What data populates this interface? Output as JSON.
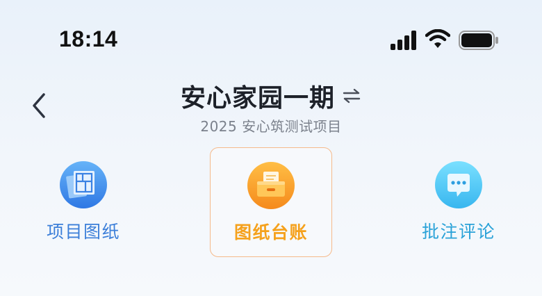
{
  "status_bar": {
    "time": "18:14",
    "icons": [
      "signal-icon",
      "wifi-icon",
      "battery-icon"
    ]
  },
  "header": {
    "back_icon": "chevron-left-icon",
    "title": "安心家园一期",
    "switch_icon": "swap-arrows-icon",
    "subtitle": "2025 安心筑测试项目"
  },
  "nav": {
    "items": [
      {
        "label": "项目图纸",
        "icon": "drawings-icon",
        "color": "#3c7fd9",
        "active": false
      },
      {
        "label": "图纸台账",
        "icon": "ledger-drawer-icon",
        "color": "#f5a11c",
        "active": true
      },
      {
        "label": "批注评论",
        "icon": "comment-bubble-icon",
        "color": "#2aa2d8",
        "active": false
      }
    ]
  },
  "colors": {
    "active_border": "#f5b98a",
    "title": "#1d2129",
    "subtitle": "#7b818c"
  }
}
